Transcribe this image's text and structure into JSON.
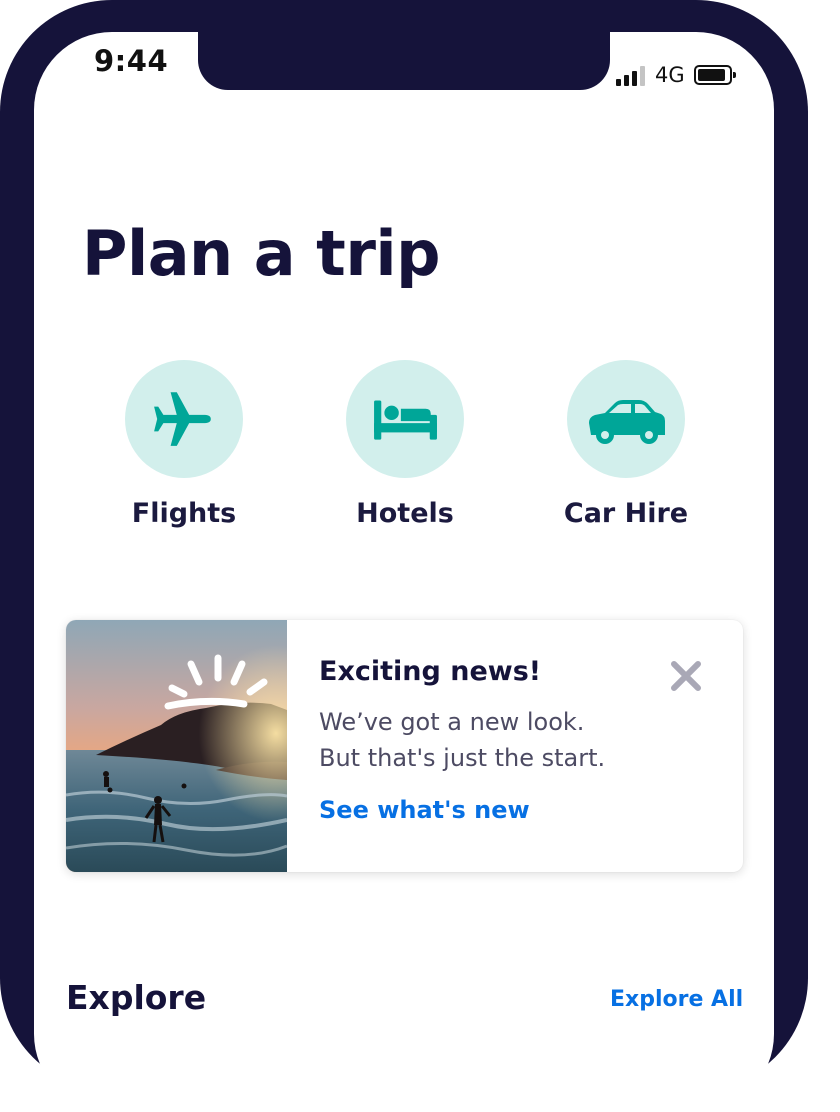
{
  "status_bar": {
    "time": "9:44",
    "network": "4G",
    "icons": [
      "signal-icon",
      "battery-icon"
    ]
  },
  "title": "Plan a trip",
  "quick_actions": [
    {
      "label": "Flights",
      "icon": "airplane-icon"
    },
    {
      "label": "Hotels",
      "icon": "bed-icon"
    },
    {
      "label": "Car Hire",
      "icon": "car-icon"
    }
  ],
  "promo_card": {
    "title": "Exciting news!",
    "line1": "We’ve got a new look.",
    "line2": "But that's just the start.",
    "link": "See what's new",
    "close_icon": "close-icon",
    "image": "beach-sunset-photo"
  },
  "explore": {
    "title": "Explore",
    "link": "Explore All"
  },
  "colors": {
    "frame": "#15133a",
    "accent_circle": "#d2efec",
    "icon_teal": "#00a698",
    "link_blue": "#0770e3",
    "heading": "#15133a"
  }
}
